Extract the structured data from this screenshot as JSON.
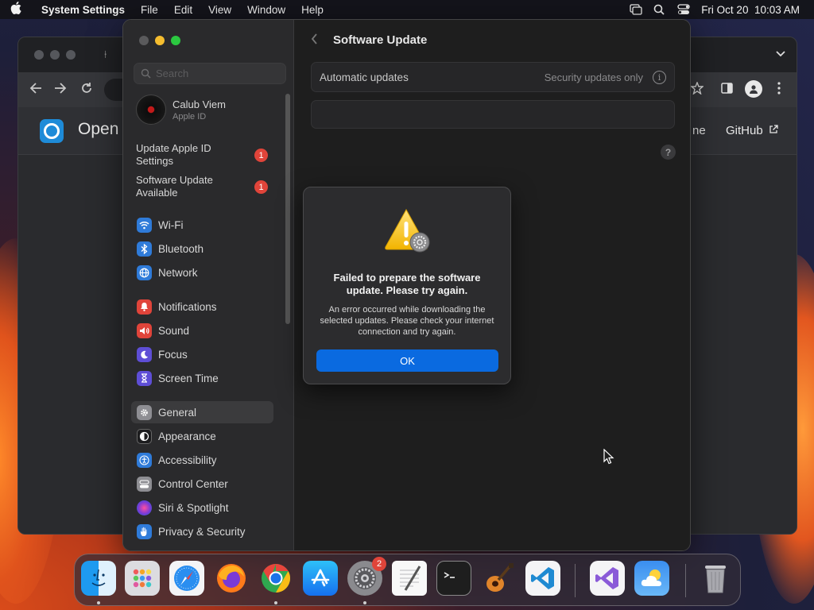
{
  "menubar": {
    "app_name": "System Settings",
    "menus": [
      "File",
      "Edit",
      "View",
      "Window",
      "Help"
    ],
    "datetime": "Fri Oct 20  10:03 AM"
  },
  "browser": {
    "site_title": "Open",
    "links": {
      "ne_partial": "ne",
      "github": "GitHub"
    }
  },
  "settings": {
    "search": {
      "placeholder": "Search"
    },
    "account": {
      "name": "Calub Viem",
      "sub": "Apple ID"
    },
    "alerts": [
      {
        "label": "Update Apple ID Settings",
        "badge": "1"
      },
      {
        "label": "Software Update Available",
        "badge": "1"
      }
    ],
    "sidebar_items": [
      {
        "label": "Wi-Fi",
        "color": "#2f7bd9",
        "icon": "wifi-icon"
      },
      {
        "label": "Bluetooth",
        "color": "#2f7bd9",
        "icon": "bluetooth-icon"
      },
      {
        "label": "Network",
        "color": "#2f7bd9",
        "icon": "globe-icon"
      },
      {
        "label": "Notifications",
        "color": "#e0443a",
        "icon": "bell-icon"
      },
      {
        "label": "Sound",
        "color": "#e0443a",
        "icon": "speaker-icon"
      },
      {
        "label": "Focus",
        "color": "#5e4ed6",
        "icon": "moon-icon"
      },
      {
        "label": "Screen Time",
        "color": "#5e4ed6",
        "icon": "hourglass-icon"
      },
      {
        "label": "General",
        "color": "#8e8e93",
        "icon": "gear-icon",
        "selected": true
      },
      {
        "label": "Appearance",
        "color": "#1c1c1e",
        "icon": "appearance-icon"
      },
      {
        "label": "Accessibility",
        "color": "#2f7bd9",
        "icon": "accessibility-icon"
      },
      {
        "label": "Control Center",
        "color": "#8e8e93",
        "icon": "control-center-icon"
      },
      {
        "label": "Siri & Spotlight",
        "color": "#c23fb0",
        "icon": "siri-icon"
      },
      {
        "label": "Privacy & Security",
        "color": "#2f7bd9",
        "icon": "hand-icon"
      }
    ],
    "content": {
      "title": "Software Update",
      "auto_updates_label": "Automatic updates",
      "auto_updates_value": "Security updates only"
    }
  },
  "dialog": {
    "title": "Failed to prepare the software update. Please try again.",
    "message": "An error occurred while downloading the selected updates. Please check your internet connection and try again.",
    "ok_label": "OK"
  },
  "dock": {
    "apps": [
      "Finder",
      "Launchpad",
      "Safari",
      "Firefox",
      "Chrome",
      "App Store",
      "System Settings",
      "TextEdit",
      "Terminal",
      "GarageBand",
      "Visual Studio Code",
      "Visual Studio",
      "Weather",
      "Trash"
    ],
    "settings_badge": "2"
  }
}
